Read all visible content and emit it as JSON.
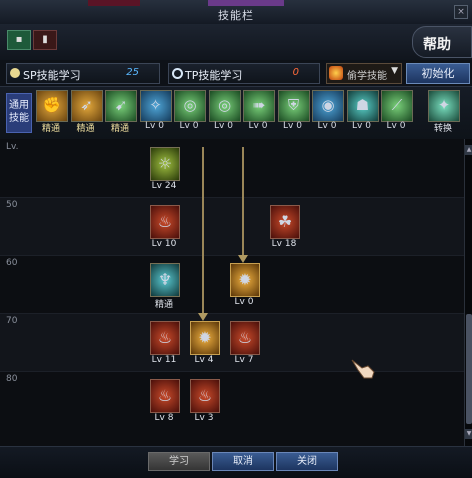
{
  "window": {
    "title": "技能栏"
  },
  "topbar": {
    "help_label": "帮助"
  },
  "points": {
    "sp_label": "SP技能学习",
    "sp_value": "25",
    "tp_label": "TP技能学习",
    "tp_value": "0",
    "dropdown_value": "偷学技能",
    "init_label": "初始化"
  },
  "common": {
    "label": "通用技能",
    "skills": [
      {
        "label": "精通",
        "color": "gold",
        "icon": "strike-icon"
      },
      {
        "label": "精通",
        "color": "gold",
        "icon": "kick-icon"
      },
      {
        "label": "精通",
        "color": "green",
        "icon": "leap-icon"
      },
      {
        "label": "Lv 0",
        "color": "blue",
        "icon": "wing-icon"
      },
      {
        "label": "Lv 0",
        "color": "green",
        "icon": "target-icon"
      },
      {
        "label": "Lv 0",
        "color": "green",
        "icon": "target-icon"
      },
      {
        "label": "Lv 0",
        "color": "green",
        "icon": "dash-icon"
      },
      {
        "label": "Lv 0",
        "color": "green",
        "icon": "guard-icon"
      },
      {
        "label": "Lv 0",
        "color": "blue",
        "icon": "vortex-icon"
      },
      {
        "label": "Lv 0",
        "color": "teal",
        "icon": "body-icon"
      },
      {
        "label": "Lv 0",
        "color": "green",
        "icon": "slash-icon"
      }
    ],
    "convert_label": "转换"
  },
  "tree": {
    "header": "Lv.",
    "levels": [
      "50",
      "60",
      "70",
      "80"
    ],
    "skills": [
      {
        "id": "s1",
        "lv": "Lv 24",
        "color": "olive"
      },
      {
        "id": "s2",
        "lv": "Lv 10",
        "color": "red"
      },
      {
        "id": "s3",
        "lv": "Lv 18",
        "color": "red"
      },
      {
        "id": "s4",
        "lv": "精通",
        "color": "teal"
      },
      {
        "id": "s5",
        "lv": "Lv 0",
        "color": "gold"
      },
      {
        "id": "s6",
        "lv": "Lv 11",
        "color": "red"
      },
      {
        "id": "s7",
        "lv": "Lv 4",
        "color": "gold"
      },
      {
        "id": "s8",
        "lv": "Lv 7",
        "color": "red"
      },
      {
        "id": "s9",
        "lv": "Lv 8",
        "color": "red"
      },
      {
        "id": "s10",
        "lv": "Lv 3",
        "color": "red"
      }
    ]
  },
  "bottom": {
    "learn": "学习",
    "cancel": "取消",
    "close": "关闭"
  }
}
